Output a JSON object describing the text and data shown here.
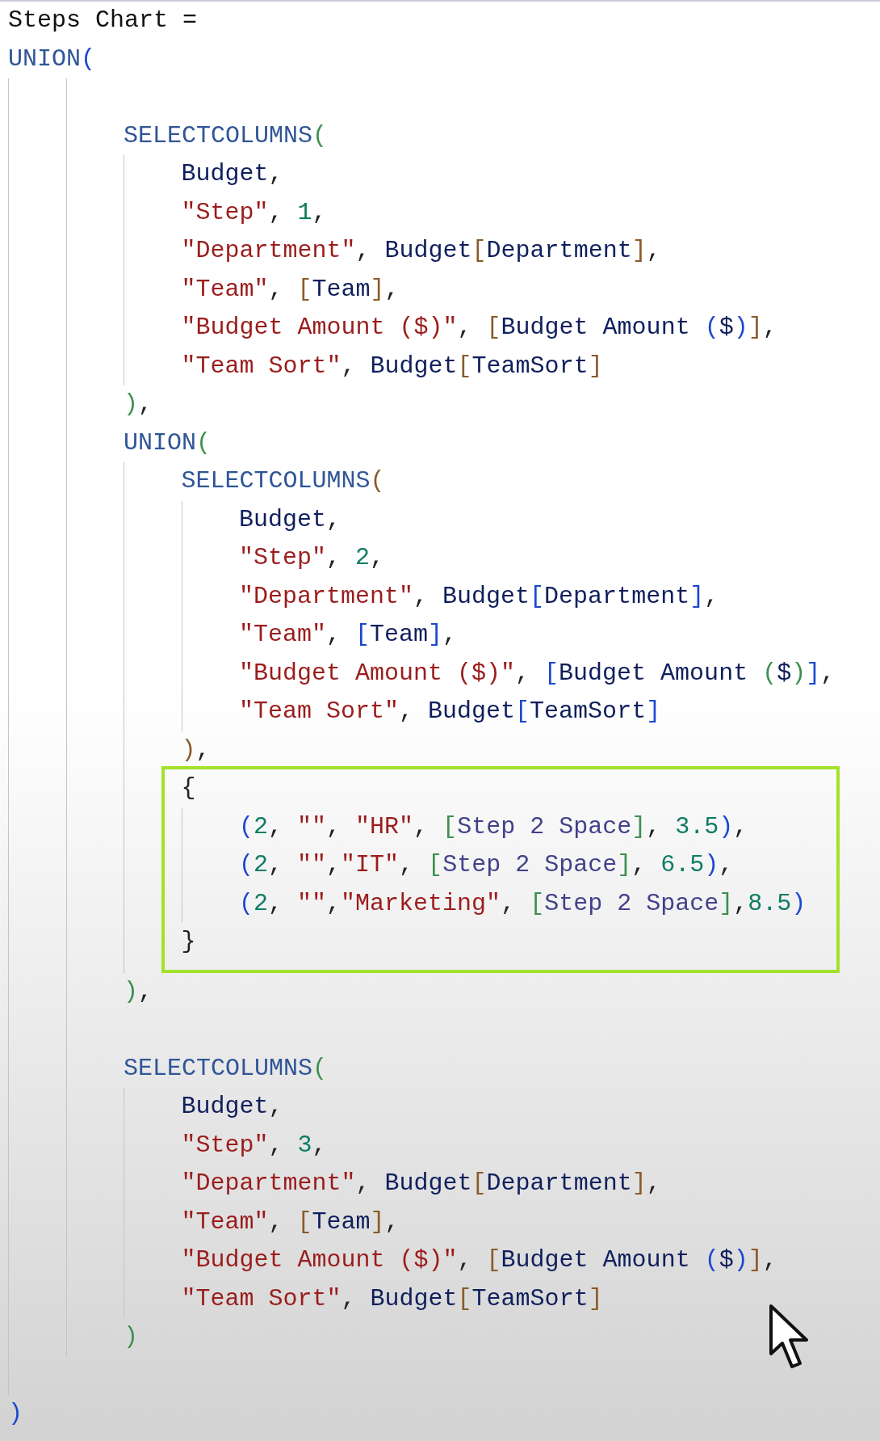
{
  "editor": {
    "lines": [
      {
        "kind": "line",
        "tokens": [
          {
            "text": "Steps Chart =",
            "color": "#111111"
          }
        ]
      },
      {
        "kind": "line",
        "tokens": [
          {
            "text": "UNION",
            "color": "#2f5597"
          },
          {
            "text": "(",
            "color": "#1b47d1"
          }
        ]
      },
      {
        "kind": "block",
        "children": [
          {
            "kind": "block",
            "children": [
              {
                "kind": "blank"
              },
              {
                "kind": "line",
                "tokens": [
                  {
                    "text": "SELECTCOLUMNS",
                    "color": "#2f5597"
                  },
                  {
                    "text": "(",
                    "color": "#3f8f4f"
                  }
                ]
              },
              {
                "kind": "block",
                "children": [
                  {
                    "kind": "line",
                    "tokens": [
                      {
                        "text": "Budget",
                        "color": "#0f1f5c"
                      },
                      {
                        "text": ",",
                        "color": "#222222"
                      }
                    ]
                  },
                  {
                    "kind": "line",
                    "tokens": [
                      {
                        "text": "\"Step\"",
                        "color": "#9b1c1c"
                      },
                      {
                        "text": ", ",
                        "color": "#222222"
                      },
                      {
                        "text": "1",
                        "color": "#0e7c61"
                      },
                      {
                        "text": ",",
                        "color": "#222222"
                      }
                    ]
                  },
                  {
                    "kind": "line",
                    "tokens": [
                      {
                        "text": "\"Department\"",
                        "color": "#9b1c1c"
                      },
                      {
                        "text": ", ",
                        "color": "#222222"
                      },
                      {
                        "text": "Budget",
                        "color": "#0f1f5c"
                      },
                      {
                        "text": "[",
                        "color": "#8a5a2a"
                      },
                      {
                        "text": "Department",
                        "color": "#0f1f5c"
                      },
                      {
                        "text": "]",
                        "color": "#8a5a2a"
                      },
                      {
                        "text": ",",
                        "color": "#222222"
                      }
                    ]
                  },
                  {
                    "kind": "line",
                    "tokens": [
                      {
                        "text": "\"Team\"",
                        "color": "#9b1c1c"
                      },
                      {
                        "text": ", ",
                        "color": "#222222"
                      },
                      {
                        "text": "[",
                        "color": "#8a5a2a"
                      },
                      {
                        "text": "Team",
                        "color": "#0f1f5c"
                      },
                      {
                        "text": "]",
                        "color": "#8a5a2a"
                      },
                      {
                        "text": ",",
                        "color": "#222222"
                      }
                    ]
                  },
                  {
                    "kind": "line",
                    "tokens": [
                      {
                        "text": "\"Budget Amount ($)\"",
                        "color": "#9b1c1c"
                      },
                      {
                        "text": ", ",
                        "color": "#222222"
                      },
                      {
                        "text": "[",
                        "color": "#8a5a2a"
                      },
                      {
                        "text": "Budget Amount ",
                        "color": "#0f1f5c"
                      },
                      {
                        "text": "(",
                        "color": "#1b47d1"
                      },
                      {
                        "text": "$",
                        "color": "#0f1f5c"
                      },
                      {
                        "text": ")",
                        "color": "#1b47d1"
                      },
                      {
                        "text": "]",
                        "color": "#8a5a2a"
                      },
                      {
                        "text": ",",
                        "color": "#222222"
                      }
                    ]
                  },
                  {
                    "kind": "line",
                    "tokens": [
                      {
                        "text": "\"Team Sort\"",
                        "color": "#9b1c1c"
                      },
                      {
                        "text": ", ",
                        "color": "#222222"
                      },
                      {
                        "text": "Budget",
                        "color": "#0f1f5c"
                      },
                      {
                        "text": "[",
                        "color": "#8a5a2a"
                      },
                      {
                        "text": "TeamSort",
                        "color": "#0f1f5c"
                      },
                      {
                        "text": "]",
                        "color": "#8a5a2a"
                      }
                    ]
                  }
                ]
              },
              {
                "kind": "line",
                "tokens": [
                  {
                    "text": ")",
                    "color": "#3f8f4f"
                  },
                  {
                    "text": ",",
                    "color": "#222222"
                  }
                ]
              },
              {
                "kind": "line",
                "tokens": [
                  {
                    "text": "UNION",
                    "color": "#2f5597"
                  },
                  {
                    "text": "(",
                    "color": "#3f8f4f"
                  }
                ]
              },
              {
                "kind": "block",
                "children": [
                  {
                    "kind": "line",
                    "tokens": [
                      {
                        "text": "SELECTCOLUMNS",
                        "color": "#2f5597"
                      },
                      {
                        "text": "(",
                        "color": "#8a5a2a"
                      }
                    ]
                  },
                  {
                    "kind": "block",
                    "children": [
                      {
                        "kind": "line",
                        "tokens": [
                          {
                            "text": "Budget",
                            "color": "#0f1f5c"
                          },
                          {
                            "text": ",",
                            "color": "#222222"
                          }
                        ]
                      },
                      {
                        "kind": "line",
                        "tokens": [
                          {
                            "text": "\"Step\"",
                            "color": "#9b1c1c"
                          },
                          {
                            "text": ", ",
                            "color": "#222222"
                          },
                          {
                            "text": "2",
                            "color": "#0e7c61"
                          },
                          {
                            "text": ",",
                            "color": "#222222"
                          }
                        ]
                      },
                      {
                        "kind": "line",
                        "tokens": [
                          {
                            "text": "\"Department\"",
                            "color": "#9b1c1c"
                          },
                          {
                            "text": ", ",
                            "color": "#222222"
                          },
                          {
                            "text": "Budget",
                            "color": "#0f1f5c"
                          },
                          {
                            "text": "[",
                            "color": "#1b47d1"
                          },
                          {
                            "text": "Department",
                            "color": "#0f1f5c"
                          },
                          {
                            "text": "]",
                            "color": "#1b47d1"
                          },
                          {
                            "text": ",",
                            "color": "#222222"
                          }
                        ]
                      },
                      {
                        "kind": "line",
                        "tokens": [
                          {
                            "text": "\"Team\"",
                            "color": "#9b1c1c"
                          },
                          {
                            "text": ", ",
                            "color": "#222222"
                          },
                          {
                            "text": "[",
                            "color": "#1b47d1"
                          },
                          {
                            "text": "Team",
                            "color": "#0f1f5c"
                          },
                          {
                            "text": "]",
                            "color": "#1b47d1"
                          },
                          {
                            "text": ",",
                            "color": "#222222"
                          }
                        ]
                      },
                      {
                        "kind": "line",
                        "tokens": [
                          {
                            "text": "\"Budget Amount ($)\"",
                            "color": "#9b1c1c"
                          },
                          {
                            "text": ", ",
                            "color": "#222222"
                          },
                          {
                            "text": "[",
                            "color": "#1b47d1"
                          },
                          {
                            "text": "Budget Amount ",
                            "color": "#0f1f5c"
                          },
                          {
                            "text": "(",
                            "color": "#3f8f4f"
                          },
                          {
                            "text": "$",
                            "color": "#0f1f5c"
                          },
                          {
                            "text": ")",
                            "color": "#3f8f4f"
                          },
                          {
                            "text": "]",
                            "color": "#1b47d1"
                          },
                          {
                            "text": ",",
                            "color": "#222222"
                          }
                        ]
                      },
                      {
                        "kind": "line",
                        "tokens": [
                          {
                            "text": "\"Team Sort\"",
                            "color": "#9b1c1c"
                          },
                          {
                            "text": ", ",
                            "color": "#222222"
                          },
                          {
                            "text": "Budget",
                            "color": "#0f1f5c"
                          },
                          {
                            "text": "[",
                            "color": "#1b47d1"
                          },
                          {
                            "text": "TeamSort",
                            "color": "#0f1f5c"
                          },
                          {
                            "text": "]",
                            "color": "#1b47d1"
                          }
                        ]
                      }
                    ]
                  },
                  {
                    "kind": "line",
                    "tokens": [
                      {
                        "text": ")",
                        "color": "#8a5a2a"
                      },
                      {
                        "text": ",",
                        "color": "#222222"
                      }
                    ]
                  },
                  {
                    "kind": "highlight",
                    "children": [
                      {
                        "kind": "line",
                        "tokens": [
                          {
                            "text": "{",
                            "color": "#222222"
                          }
                        ]
                      },
                      {
                        "kind": "block",
                        "children": [
                          {
                            "kind": "line",
                            "tokens": [
                              {
                                "text": "(",
                                "color": "#1b47d1"
                              },
                              {
                                "text": "2",
                                "color": "#0e7c61"
                              },
                              {
                                "text": ", ",
                                "color": "#222222"
                              },
                              {
                                "text": "\"\"",
                                "color": "#9b1c1c"
                              },
                              {
                                "text": ", ",
                                "color": "#222222"
                              },
                              {
                                "text": "\"HR\"",
                                "color": "#9b1c1c"
                              },
                              {
                                "text": ", ",
                                "color": "#222222"
                              },
                              {
                                "text": "[",
                                "color": "#3f8f4f"
                              },
                              {
                                "text": "Step 2 Space",
                                "color": "#43408a"
                              },
                              {
                                "text": "]",
                                "color": "#3f8f4f"
                              },
                              {
                                "text": ", ",
                                "color": "#222222"
                              },
                              {
                                "text": "3.5",
                                "color": "#0e7c61"
                              },
                              {
                                "text": ")",
                                "color": "#1b47d1"
                              },
                              {
                                "text": ",",
                                "color": "#222222"
                              }
                            ]
                          },
                          {
                            "kind": "line",
                            "tokens": [
                              {
                                "text": "(",
                                "color": "#1b47d1"
                              },
                              {
                                "text": "2",
                                "color": "#0e7c61"
                              },
                              {
                                "text": ", ",
                                "color": "#222222"
                              },
                              {
                                "text": "\"\"",
                                "color": "#9b1c1c"
                              },
                              {
                                "text": ",",
                                "color": "#222222"
                              },
                              {
                                "text": "\"IT\"",
                                "color": "#9b1c1c"
                              },
                              {
                                "text": ", ",
                                "color": "#222222"
                              },
                              {
                                "text": "[",
                                "color": "#3f8f4f"
                              },
                              {
                                "text": "Step 2 Space",
                                "color": "#43408a"
                              },
                              {
                                "text": "]",
                                "color": "#3f8f4f"
                              },
                              {
                                "text": ", ",
                                "color": "#222222"
                              },
                              {
                                "text": "6.5",
                                "color": "#0e7c61"
                              },
                              {
                                "text": ")",
                                "color": "#1b47d1"
                              },
                              {
                                "text": ",",
                                "color": "#222222"
                              }
                            ]
                          },
                          {
                            "kind": "line",
                            "tokens": [
                              {
                                "text": "(",
                                "color": "#1b47d1"
                              },
                              {
                                "text": "2",
                                "color": "#0e7c61"
                              },
                              {
                                "text": ", ",
                                "color": "#222222"
                              },
                              {
                                "text": "\"\"",
                                "color": "#9b1c1c"
                              },
                              {
                                "text": ",",
                                "color": "#222222"
                              },
                              {
                                "text": "\"Marketing\"",
                                "color": "#9b1c1c"
                              },
                              {
                                "text": ", ",
                                "color": "#222222"
                              },
                              {
                                "text": "[",
                                "color": "#3f8f4f"
                              },
                              {
                                "text": "Step 2 Space",
                                "color": "#43408a"
                              },
                              {
                                "text": "]",
                                "color": "#3f8f4f"
                              },
                              {
                                "text": ",",
                                "color": "#222222"
                              },
                              {
                                "text": "8.5",
                                "color": "#0e7c61"
                              },
                              {
                                "text": ")",
                                "color": "#1b47d1"
                              }
                            ]
                          }
                        ]
                      },
                      {
                        "kind": "line",
                        "tokens": [
                          {
                            "text": "}",
                            "color": "#222222"
                          }
                        ]
                      }
                    ]
                  }
                ]
              },
              {
                "kind": "line",
                "tokens": [
                  {
                    "text": ")",
                    "color": "#3f8f4f"
                  },
                  {
                    "text": ",",
                    "color": "#222222"
                  }
                ]
              },
              {
                "kind": "blank"
              },
              {
                "kind": "line",
                "tokens": [
                  {
                    "text": "SELECTCOLUMNS",
                    "color": "#2f5597"
                  },
                  {
                    "text": "(",
                    "color": "#3f8f4f"
                  }
                ]
              },
              {
                "kind": "block",
                "children": [
                  {
                    "kind": "line",
                    "tokens": [
                      {
                        "text": "Budget",
                        "color": "#0f1f5c"
                      },
                      {
                        "text": ",",
                        "color": "#222222"
                      }
                    ]
                  },
                  {
                    "kind": "line",
                    "tokens": [
                      {
                        "text": "\"Step\"",
                        "color": "#9b1c1c"
                      },
                      {
                        "text": ", ",
                        "color": "#222222"
                      },
                      {
                        "text": "3",
                        "color": "#0e7c61"
                      },
                      {
                        "text": ",",
                        "color": "#222222"
                      }
                    ]
                  },
                  {
                    "kind": "line",
                    "tokens": [
                      {
                        "text": "\"Department\"",
                        "color": "#9b1c1c"
                      },
                      {
                        "text": ", ",
                        "color": "#222222"
                      },
                      {
                        "text": "Budget",
                        "color": "#0f1f5c"
                      },
                      {
                        "text": "[",
                        "color": "#8a5a2a"
                      },
                      {
                        "text": "Department",
                        "color": "#0f1f5c"
                      },
                      {
                        "text": "]",
                        "color": "#8a5a2a"
                      },
                      {
                        "text": ",",
                        "color": "#222222"
                      }
                    ]
                  },
                  {
                    "kind": "line",
                    "tokens": [
                      {
                        "text": "\"Team\"",
                        "color": "#9b1c1c"
                      },
                      {
                        "text": ", ",
                        "color": "#222222"
                      },
                      {
                        "text": "[",
                        "color": "#8a5a2a"
                      },
                      {
                        "text": "Team",
                        "color": "#0f1f5c"
                      },
                      {
                        "text": "]",
                        "color": "#8a5a2a"
                      },
                      {
                        "text": ",",
                        "color": "#222222"
                      }
                    ]
                  },
                  {
                    "kind": "line",
                    "tokens": [
                      {
                        "text": "\"Budget Amount ($)\"",
                        "color": "#9b1c1c"
                      },
                      {
                        "text": ", ",
                        "color": "#222222"
                      },
                      {
                        "text": "[",
                        "color": "#8a5a2a"
                      },
                      {
                        "text": "Budget Amount ",
                        "color": "#0f1f5c"
                      },
                      {
                        "text": "(",
                        "color": "#1b47d1"
                      },
                      {
                        "text": "$",
                        "color": "#0f1f5c"
                      },
                      {
                        "text": ")",
                        "color": "#1b47d1"
                      },
                      {
                        "text": "]",
                        "color": "#8a5a2a"
                      },
                      {
                        "text": ",",
                        "color": "#222222"
                      }
                    ]
                  },
                  {
                    "kind": "line",
                    "tokens": [
                      {
                        "text": "\"Team Sort\"",
                        "color": "#9b1c1c"
                      },
                      {
                        "text": ", ",
                        "color": "#222222"
                      },
                      {
                        "text": "Budget",
                        "color": "#0f1f5c"
                      },
                      {
                        "text": "[",
                        "color": "#8a5a2a"
                      },
                      {
                        "text": "TeamSort",
                        "color": "#0f1f5c"
                      },
                      {
                        "text": "]",
                        "color": "#8a5a2a"
                      }
                    ]
                  }
                ]
              },
              {
                "kind": "line",
                "tokens": [
                  {
                    "text": ")",
                    "color": "#3f8f4f"
                  }
                ]
              }
            ]
          },
          {
            "kind": "blank"
          }
        ]
      },
      {
        "kind": "line",
        "tokens": [
          {
            "text": ")",
            "color": "#1b47d1"
          }
        ]
      }
    ]
  }
}
